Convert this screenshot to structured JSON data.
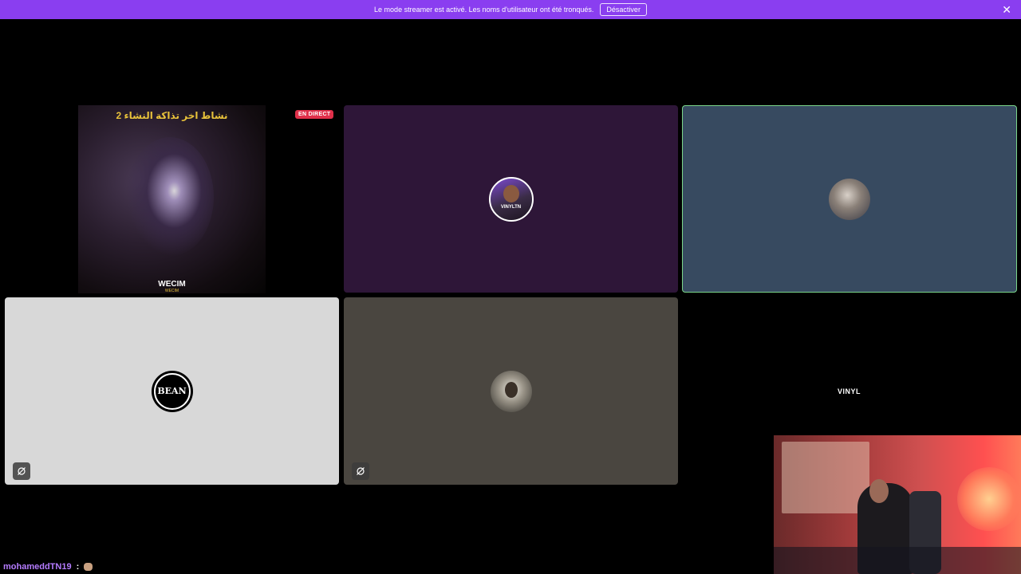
{
  "banner": {
    "message": "Le mode streamer est activé. Les noms d'utilisateur ont été tronqués.",
    "disable_label": "Désactiver",
    "close_icon": "close-icon",
    "color": "#8a3ef0"
  },
  "tiles": {
    "stream": {
      "badge": "EN DIRECT",
      "cover_title": "2 نشاط اخر تذاكة النشاء",
      "cover_artist": "WECIM",
      "cover_artist_small": "WECIM"
    },
    "user1": {
      "avatar_label": "VINYLTN",
      "color": "#2e1638"
    },
    "user2": {
      "color": "#374a60",
      "speaking_border": "#7bd68a"
    },
    "user3": {
      "avatar_text": "BEAN",
      "color": "#d8d8d8"
    },
    "user4": {
      "color": "#4a4640"
    },
    "user5": {
      "avatar_text": "VINYL"
    }
  },
  "chat": {
    "username": "mohameddTN19",
    "separator": ":",
    "emote": "hamster-emote"
  }
}
